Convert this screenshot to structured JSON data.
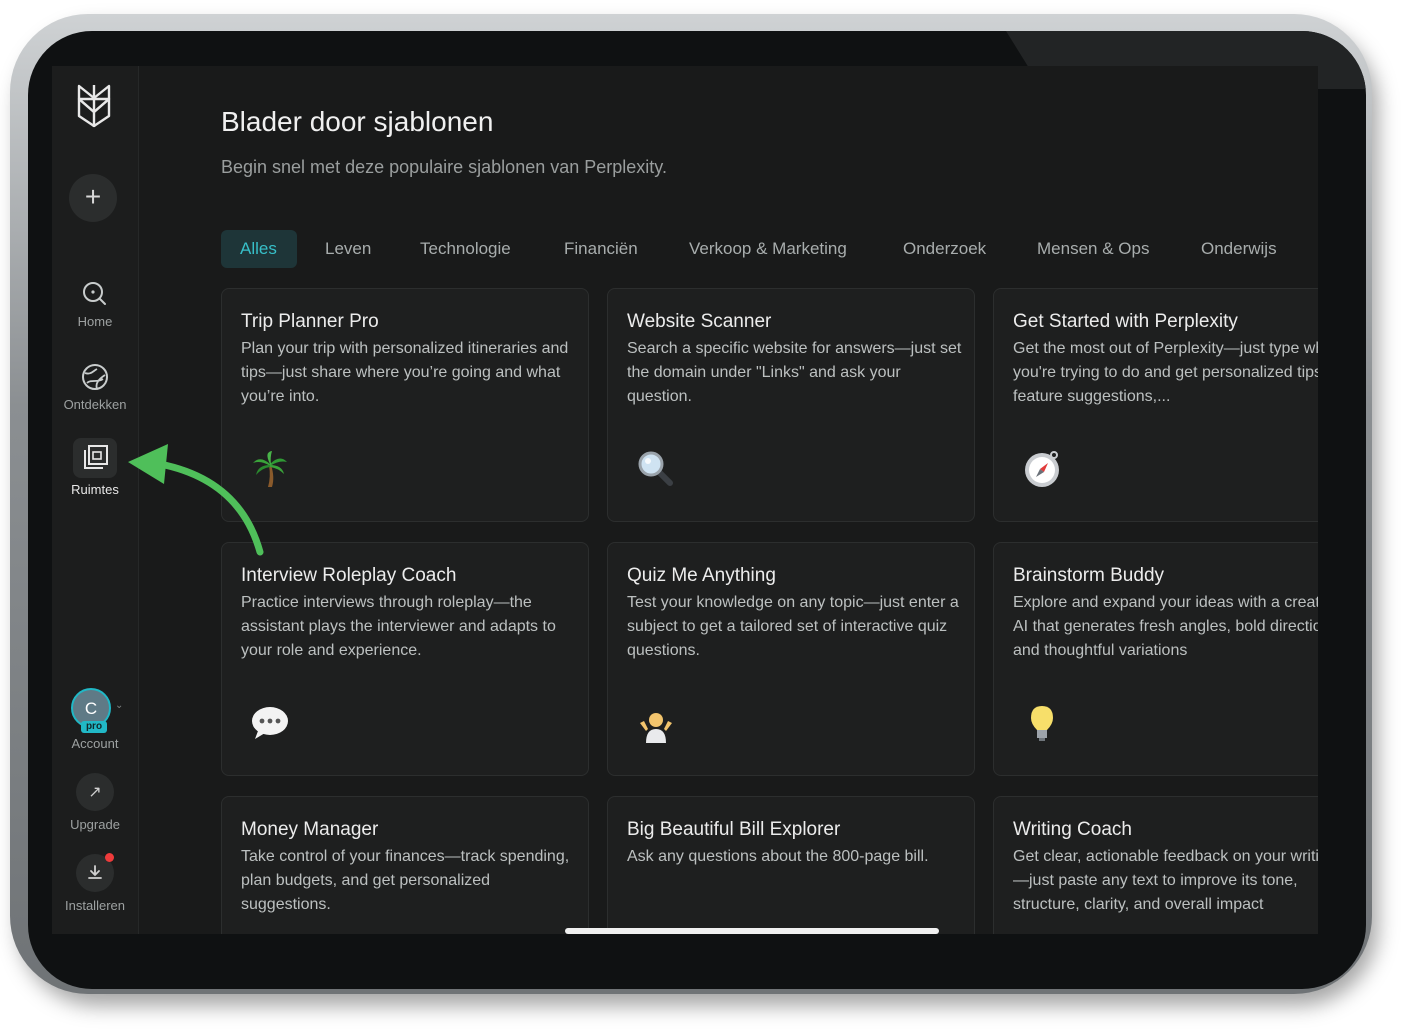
{
  "sidebar": {
    "nav": [
      {
        "label": "Home",
        "icon": "search-icon"
      },
      {
        "label": "Ontdekken",
        "icon": "globe-icon"
      },
      {
        "label": "Ruimtes",
        "icon": "spaces-icon"
      }
    ],
    "account": {
      "initial": "C",
      "badge": "pro",
      "label": "Account"
    },
    "upgrade_label": "Upgrade",
    "install_label": "Installeren"
  },
  "main": {
    "title": "Blader door sjablonen",
    "subtitle": "Begin snel met deze populaire sjablonen van Perplexity.",
    "tabs": [
      "Alles",
      "Leven",
      "Technologie",
      "Financiën",
      "Verkoop & Marketing",
      "Onderzoek",
      "Mensen & Ops",
      "Onderwijs"
    ],
    "active_tab": "Alles",
    "cards": [
      {
        "title": "Trip Planner Pro",
        "desc": "Plan your trip with personalized itineraries and tips—just share where you’re going and what you’re into.",
        "icon": "palm-tree-icon"
      },
      {
        "title": "Website Scanner",
        "desc": "Search a specific website for answers—just set the domain under \"Links\" and ask your question.",
        "icon": "magnifier-icon"
      },
      {
        "title": "Get Started with Perplexity",
        "desc": "Get the most out of Perplexity—just type what you're trying to do and get personalized tips, feature suggestions,...",
        "icon": "compass-icon"
      },
      {
        "title": "Interview Roleplay Coach",
        "desc": "Practice interviews through roleplay—the assistant plays the interviewer and adapts to your role and experience.",
        "icon": "speech-bubble-icon"
      },
      {
        "title": "Quiz Me Anything",
        "desc": "Test your knowledge on any topic—just enter a subject to get a tailored set of interactive quiz questions.",
        "icon": "shrug-person-icon"
      },
      {
        "title": "Brainstorm Buddy",
        "desc": "Explore and expand your ideas with a creative AI that generates fresh angles, bold directions, and thoughtful variations",
        "icon": "lightbulb-icon"
      },
      {
        "title": "Money Manager",
        "desc": "Take control of your finances—track spending, plan budgets, and get personalized suggestions.",
        "icon": ""
      },
      {
        "title": "Big Beautiful Bill Explorer",
        "desc": "Ask any questions about the 800-page bill.",
        "icon": ""
      },
      {
        "title": "Writing Coach",
        "desc": "Get clear, actionable feedback on your writing—just paste any text to improve its tone, structure, clarity, and overall impact",
        "icon": ""
      }
    ]
  },
  "colors": {
    "accent": "#37bfc8",
    "background": "#191a1a",
    "arrow": "#4fbf5a"
  }
}
